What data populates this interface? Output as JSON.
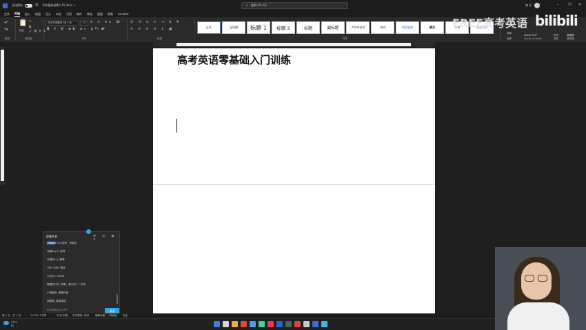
{
  "titlebar": {
    "autosave_label": "自动保存",
    "doc_name": "写作基础训练5-15.docx ∨",
    "search_placeholder": "搜索(Alt+Q)",
    "user_name": "海 邓"
  },
  "menu": {
    "tabs": [
      "文件",
      "开始",
      "插入",
      "绘图",
      "设计",
      "布局",
      "引用",
      "邮件",
      "审阅",
      "视图",
      "帮助",
      "Acrobat"
    ],
    "active_index": 1
  },
  "ribbon": {
    "font_name": "方正书宋简体 GB+ 宋",
    "font_size": "32",
    "group_labels": {
      "undo": "撤消",
      "clipboard": "剪贴板",
      "font": "字体",
      "paragraph": "段落",
      "styles": "样式",
      "editing": "编辑",
      "acrobat": "Adobe Acrobat",
      "voice": "语音",
      "addins": "编辑器"
    },
    "paste_label": "粘贴",
    "format_painter_label": "格式刷",
    "styles": [
      {
        "label": "正文",
        "variant": "first"
      },
      {
        "label": "无间隔",
        "variant": ""
      },
      {
        "label": "标题 1",
        "variant": "h1"
      },
      {
        "label": "标题 2",
        "variant": "h2"
      },
      {
        "label": "标题",
        "variant": "t"
      },
      {
        "label": "副标题",
        "variant": "sub"
      },
      {
        "label": "不明显强调",
        "variant": "em"
      },
      {
        "label": "强调",
        "variant": "em"
      },
      {
        "label": "明显强调",
        "variant": "blue"
      },
      {
        "label": "要点",
        "variant": "strong"
      },
      {
        "label": "引用",
        "variant": "em"
      },
      {
        "label": "明显引用",
        "variant": "blue"
      }
    ],
    "right_labels": {
      "select": "选择",
      "adobe_pdf": "Adobe PDF",
      "dictate": "听写",
      "editor": "编辑器"
    }
  },
  "watermark": {
    "text": "FREE高考英语",
    "brand": "bilibili"
  },
  "document": {
    "title": "高考英语零基础入门训练"
  },
  "panel": {
    "title": "屏幕共享",
    "lines": [
      {
        "chip": "Guest",
        "text": "Cyrs老师：全部扣"
      },
      {
        "chip": "",
        "text": "冷酷6cyrs: 那样"
      },
      {
        "chip": "",
        "text": "只是吗(1): 是啊"
      },
      {
        "chip": "",
        "text": "TME.CWE: 嘿牙"
      },
      {
        "chip": "",
        "text": "云边ee: OMGK"
      },
      {
        "chip": "",
        "text": "想提前打字: 扣啊，看不见？？扣扣"
      },
      {
        "chip": "",
        "text": "小明啥我: 嘿嘿牙齿"
      },
      {
        "chip": "",
        "text": "朋嘻嘻: 嘻嘻嘻嘻"
      }
    ],
    "input_placeholder": "和大家聊点什么吧",
    "send_label": "发送"
  },
  "statusbar": {
    "page_info": "第 1 页，共 1 页",
    "word_count": "181 个字",
    "words": "10434 个字符",
    "language": "中文(中国)",
    "text_predictions": "文本预测: 关闭",
    "accessibility": "辅助功能: 一切就绪",
    "focus": "专注"
  },
  "taskbar": {
    "temperature": "27°C",
    "weather": "阴",
    "icon_colors": [
      "#3b7fd6",
      "#d6d6d6",
      "#e8b23a",
      "#d64a3b",
      "#4a9ee8",
      "#3bd6a0",
      "#e83b5a",
      "#2a64c8",
      "#5a5a5a",
      "#d6483b",
      "#c8c8c8",
      "#3b6fd6",
      "#4ab0e8"
    ]
  },
  "colors": {
    "accent": "#2ea4e0",
    "word_blue": "#3b6fd6"
  }
}
